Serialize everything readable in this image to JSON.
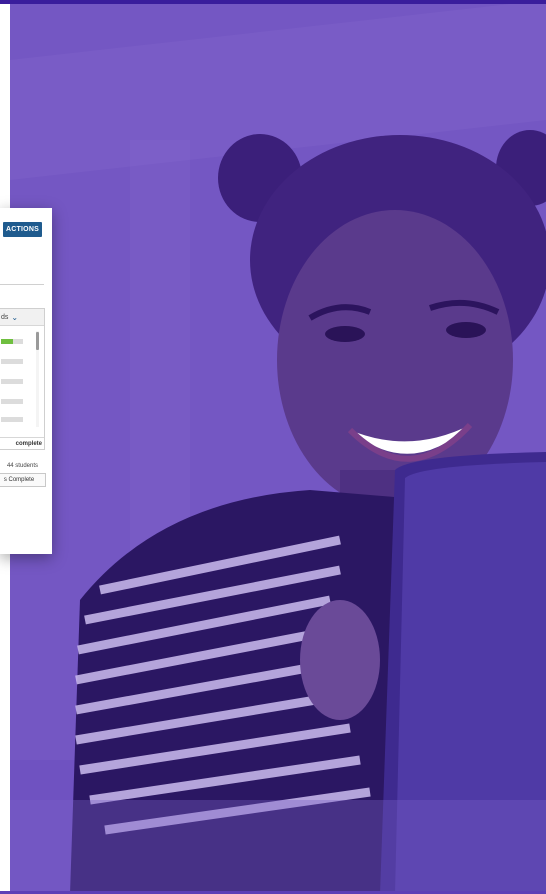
{
  "card": {
    "actions_label": "ACTIONS",
    "filter_label": "ds",
    "filter_icon": "chevron-down-icon",
    "panel_footer": "complete",
    "students_label": "44 students",
    "complete_button_label": "s Complete",
    "progress_rows": [
      0.55,
      0,
      0,
      0,
      0
    ]
  },
  "colors": {
    "overlay_purple": "#6d4ec0",
    "top_bar": "#3a1d9c",
    "actions_blue": "#1f5b8e",
    "progress_green": "#6fbf3f"
  }
}
